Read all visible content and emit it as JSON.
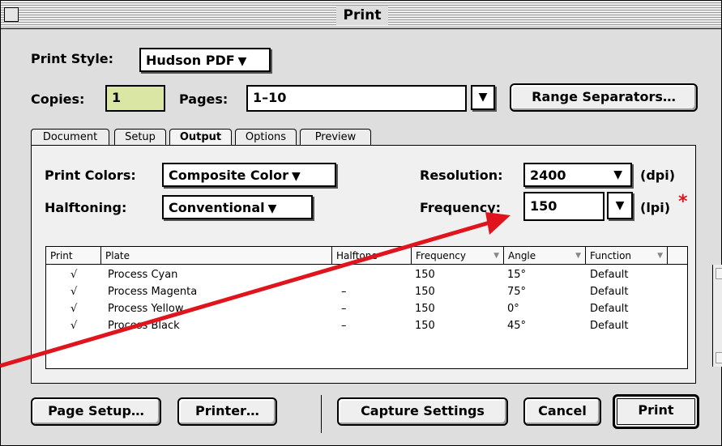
{
  "window": {
    "title": "Print"
  },
  "print_style": {
    "label": "Print Style:",
    "value": "Hudson PDF"
  },
  "copies": {
    "label": "Copies:",
    "value": "1"
  },
  "pages": {
    "label": "Pages:",
    "value": "1–10"
  },
  "range_button": "Range Separators…",
  "tabs": [
    "Document",
    "Setup",
    "Output",
    "Options",
    "Preview"
  ],
  "active_tab": "Output",
  "print_colors": {
    "label": "Print Colors:",
    "value": "Composite Color"
  },
  "halftoning": {
    "label": "Halftoning:",
    "value": "Conventional"
  },
  "resolution": {
    "label": "Resolution:",
    "value": "2400",
    "unit": "(dpi)"
  },
  "frequency": {
    "label": "Frequency:",
    "value": "150",
    "unit": "(lpi)",
    "marker": "*"
  },
  "table": {
    "headers": [
      "Print",
      "Plate",
      "Halftone",
      "Frequency",
      "Angle",
      "Function"
    ],
    "rows": [
      {
        "print": "√",
        "plate": "Process Cyan",
        "halftone": "",
        "frequency": "150",
        "angle": "15°",
        "function": "Default"
      },
      {
        "print": "√",
        "plate": "Process Magenta",
        "halftone": "–",
        "frequency": "150",
        "angle": "75°",
        "function": "Default"
      },
      {
        "print": "√",
        "plate": "Process Yellow",
        "halftone": "–",
        "frequency": "150",
        "angle": "0°",
        "function": "Default"
      },
      {
        "print": "√",
        "plate": "Process Black",
        "halftone": "–",
        "frequency": "150",
        "angle": "45°",
        "function": "Default"
      }
    ]
  },
  "buttons": {
    "page_setup": "Page Setup…",
    "printer": "Printer…",
    "capture": "Capture Settings",
    "cancel": "Cancel",
    "print": "Print"
  },
  "colors": {
    "copies_field_bg": "#d9e6a4",
    "annotation_arrow": "#e0141c"
  }
}
